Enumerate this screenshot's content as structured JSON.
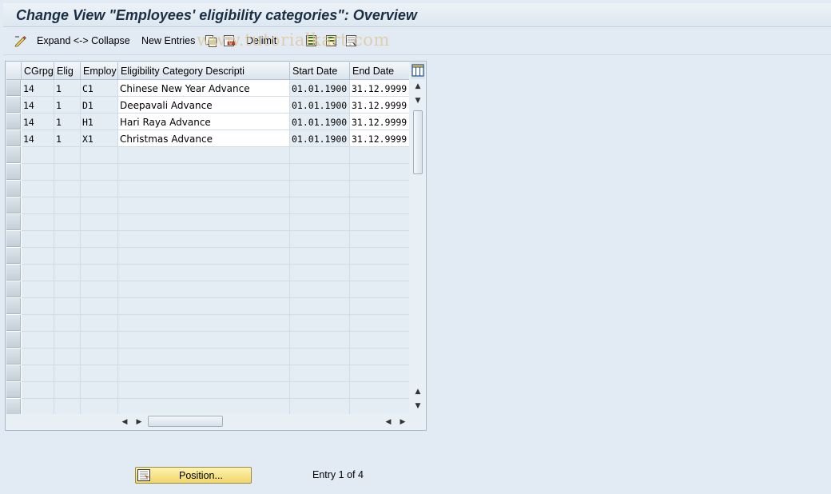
{
  "title": "Change View \"Employees' eligibility categories\": Overview",
  "toolbar": {
    "expand_collapse": "Expand <-> Collapse",
    "new_entries": "New Entries",
    "delimit": "Delimit",
    "watermark": "www.tutorialkart.com"
  },
  "table": {
    "columns": [
      "CGrpg",
      "Elig",
      "Employ",
      "Eligibility Category Descripti",
      "Start Date",
      "End Date"
    ],
    "rows": [
      {
        "cgrpg": "14",
        "elig": "1",
        "employ": "C1",
        "desc": "Chinese New Year Advance",
        "start": "01.01.1900",
        "end": "31.12.9999"
      },
      {
        "cgrpg": "14",
        "elig": "1",
        "employ": "D1",
        "desc": "Deepavali Advance",
        "start": "01.01.1900",
        "end": "31.12.9999"
      },
      {
        "cgrpg": "14",
        "elig": "1",
        "employ": "H1",
        "desc": "Hari Raya Advance",
        "start": "01.01.1900",
        "end": "31.12.9999"
      },
      {
        "cgrpg": "14",
        "elig": "1",
        "employ": "X1",
        "desc": "Christmas Advance",
        "start": "01.01.1900",
        "end": "31.12.9999"
      }
    ]
  },
  "footer": {
    "position_button": "Position...",
    "entry_info": "Entry 1 of 4"
  },
  "colors": {
    "background": "#e2ebf3",
    "readonly_cell": "#e5edf4",
    "button_yellow": "#f0d56a",
    "title_text": "#1b2e44"
  }
}
